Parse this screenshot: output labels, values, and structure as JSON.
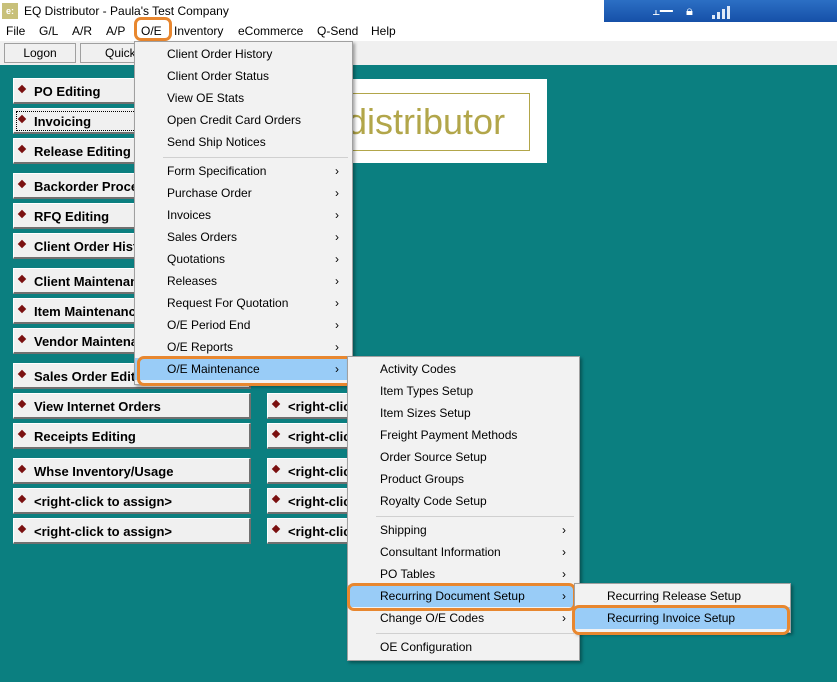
{
  "window": {
    "title": "EQ Distributor - Paula's Test Company",
    "app_icon_text": "e:"
  },
  "menubar": [
    "File",
    "G/L",
    "A/R",
    "A/P",
    "O/E",
    "Inventory",
    "eCommerce",
    "Q-Send",
    "Help"
  ],
  "toolbar": {
    "logon": "Logon",
    "quick": "Quick"
  },
  "quick_buttons_left": [
    "PO Editing",
    "Invoicing",
    "Release Editing",
    "Backorder Processing",
    "RFQ Editing",
    "Client Order History",
    "Client Maintenance",
    "Item Maintenance",
    "Vendor Maintenance",
    "Sales Order Editing",
    "View Internet Orders",
    "Receipts Editing",
    "Whse Inventory/Usage",
    "<right-click to assign>",
    "<right-click to assign>"
  ],
  "quick_buttons_right": [
    "<right-click to assign>",
    "<right-click to assign>",
    "<right-click to assign>",
    "<right-click to assign>",
    "<right-click to assign>"
  ],
  "logo_text": "distributor",
  "oe_menu": {
    "group1": [
      "Client Order History",
      "Client Order Status",
      "View OE Stats",
      "Open Credit Card Orders",
      "Send Ship Notices"
    ],
    "group2": [
      "Form Specification",
      "Purchase Order",
      "Invoices",
      "Sales Orders",
      "Quotations",
      "Releases",
      "Request For Quotation",
      "O/E Period End",
      "O/E Reports",
      "O/E Maintenance"
    ],
    "selected": "O/E Maintenance"
  },
  "maintenance_menu": {
    "group1": [
      "Activity Codes",
      "Item Types Setup",
      "Item Sizes Setup",
      "Freight Payment Methods",
      "Order Source Setup",
      "Product Groups",
      "Royalty Code Setup"
    ],
    "group2": [
      "Shipping",
      "Consultant Information",
      "PO Tables",
      "Recurring Document Setup",
      "Change O/E Codes"
    ],
    "group3": [
      "OE Configuration"
    ],
    "selected": "Recurring Document Setup"
  },
  "recurring_menu": {
    "items": [
      "Recurring Release Setup",
      "Recurring Invoice Setup"
    ],
    "selected": "Recurring Invoice Setup"
  },
  "colors": {
    "background": "#0b7f80",
    "highlight": "#99ccf7",
    "callout": "#e8872f",
    "logo": "#b2a64a"
  }
}
